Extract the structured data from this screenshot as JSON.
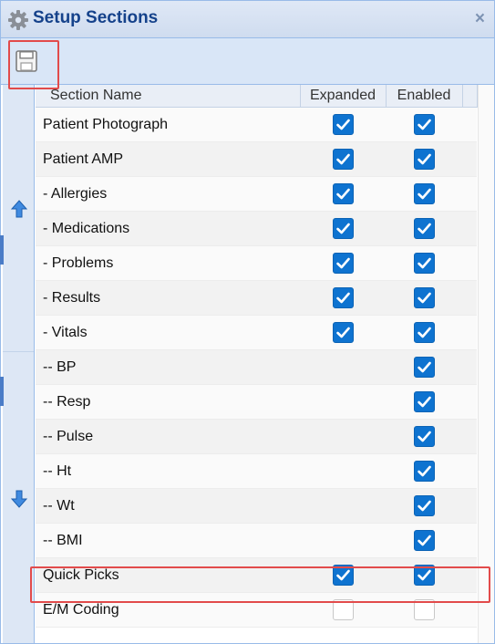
{
  "dialog": {
    "title": "Setup Sections",
    "close_label": "×",
    "icon": "gear-icon"
  },
  "toolbar": {
    "save_icon": "save-icon"
  },
  "grid": {
    "columns": [
      "Section Name",
      "Expanded",
      "Enabled"
    ],
    "rows": [
      {
        "name": "Patient Photograph",
        "expanded": true,
        "enabled": true
      },
      {
        "name": "Patient AMP",
        "expanded": true,
        "enabled": true
      },
      {
        "name": "- Allergies",
        "expanded": true,
        "enabled": true
      },
      {
        "name": "- Medications",
        "expanded": true,
        "enabled": true
      },
      {
        "name": "- Problems",
        "expanded": true,
        "enabled": true
      },
      {
        "name": "- Results",
        "expanded": true,
        "enabled": true
      },
      {
        "name": "- Vitals",
        "expanded": true,
        "enabled": true
      },
      {
        "name": "-- BP",
        "expanded": null,
        "enabled": true
      },
      {
        "name": "-- Resp",
        "expanded": null,
        "enabled": true
      },
      {
        "name": "-- Pulse",
        "expanded": null,
        "enabled": true
      },
      {
        "name": "-- Ht",
        "expanded": null,
        "enabled": true
      },
      {
        "name": "-- Wt",
        "expanded": null,
        "enabled": true
      },
      {
        "name": "-- BMI",
        "expanded": null,
        "enabled": true
      },
      {
        "name": "Quick Picks",
        "expanded": true,
        "enabled": true
      },
      {
        "name": "E/M Coding",
        "expanded": false,
        "enabled": false
      }
    ]
  },
  "side_buttons": {
    "up_icon": "move-up-arrow-icon",
    "down_icon": "move-down-arrow-icon"
  },
  "highlights": {
    "color": "#e24b4b"
  },
  "colors": {
    "title_text": "#15428b",
    "checkbox_checked": "#0e73d0",
    "border": "#99bbe8"
  }
}
